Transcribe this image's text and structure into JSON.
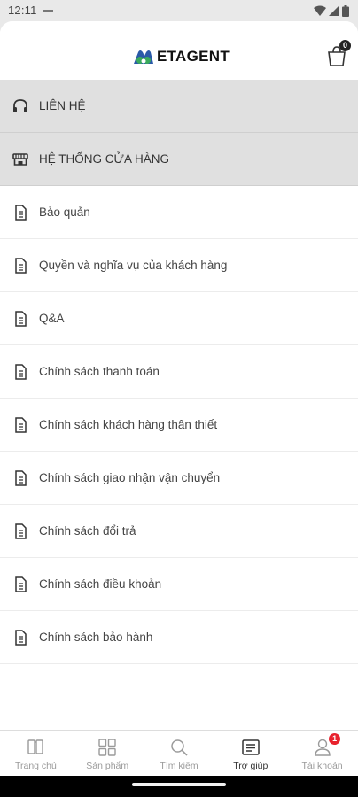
{
  "status_bar": {
    "time": "12:11"
  },
  "header": {
    "brand": "ETAGENT",
    "cart_count": "0"
  },
  "menu": {
    "items": [
      {
        "label": "LIÊN HỆ",
        "icon": "headphones-icon",
        "highlight": true
      },
      {
        "label": "HỆ THỐNG CỬA HÀNG",
        "icon": "store-icon",
        "highlight": true
      },
      {
        "label": "Bảo quản",
        "icon": "document-icon"
      },
      {
        "label": "Quyền và nghĩa vụ của khách hàng",
        "icon": "document-icon"
      },
      {
        "label": "Q&A",
        "icon": "document-icon"
      },
      {
        "label": "Chính sách thanh toán",
        "icon": "document-icon"
      },
      {
        "label": "Chính sách khách hàng thân thiết",
        "icon": "document-icon"
      },
      {
        "label": "Chính sách giao nhận vận chuyển",
        "icon": "document-icon"
      },
      {
        "label": "Chính sách đổi trả",
        "icon": "document-icon"
      },
      {
        "label": "Chính sách điều khoản",
        "icon": "document-icon"
      },
      {
        "label": "Chính sách bảo hành",
        "icon": "document-icon"
      }
    ]
  },
  "bottom_nav": {
    "items": [
      {
        "label": "Trang chủ",
        "icon": "home-icon"
      },
      {
        "label": "Sản phẩm",
        "icon": "grid-icon"
      },
      {
        "label": "Tìm kiếm",
        "icon": "search-icon"
      },
      {
        "label": "Trợ giúp",
        "icon": "help-doc-icon",
        "active": true
      },
      {
        "label": "Tài khoản",
        "icon": "account-icon",
        "badge": "1"
      }
    ]
  },
  "colors": {
    "accent_badge": "#e8222d",
    "highlight_row": "#e0e0e0",
    "logo_blue": "#2a5aa8",
    "logo_green": "#3aaa5c"
  }
}
